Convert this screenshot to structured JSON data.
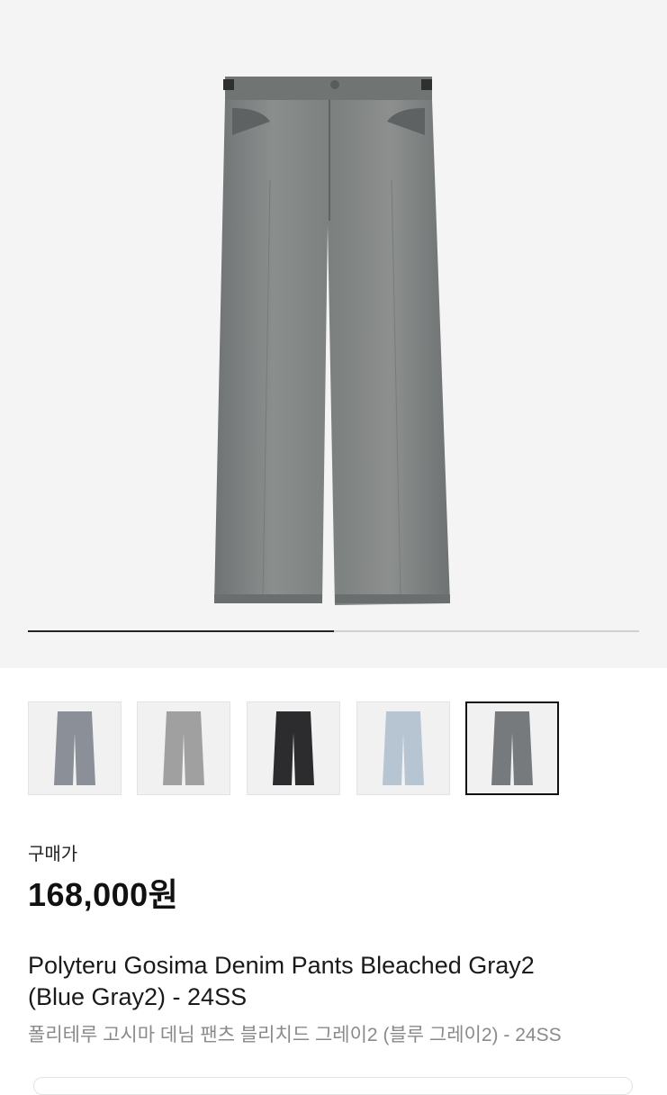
{
  "gallery": {
    "main_image": "gray-wide-denim-pants",
    "progress_fraction": 0.5,
    "thumbnails": [
      {
        "name": "thumb-gray",
        "color": "#8b9098",
        "selected": false
      },
      {
        "name": "thumb-light-gray",
        "color": "#a0a0a0",
        "selected": false
      },
      {
        "name": "thumb-black",
        "color": "#2c2c2e",
        "selected": false
      },
      {
        "name": "thumb-light-blue",
        "color": "#b7c5d2",
        "selected": false
      },
      {
        "name": "thumb-blue-gray",
        "color": "#777a7c",
        "selected": true
      }
    ]
  },
  "price": {
    "label": "구매가",
    "value": "168,000원"
  },
  "product": {
    "title_en_line1": "Polyteru Gosima Denim Pants Bleached Gray2",
    "title_en_line2": "(Blue Gray2) - 24SS",
    "title_ko": "폴리테루 고시마 데님 팬츠 블리치드 그레이2 (블루 그레이2) - 24SS"
  }
}
